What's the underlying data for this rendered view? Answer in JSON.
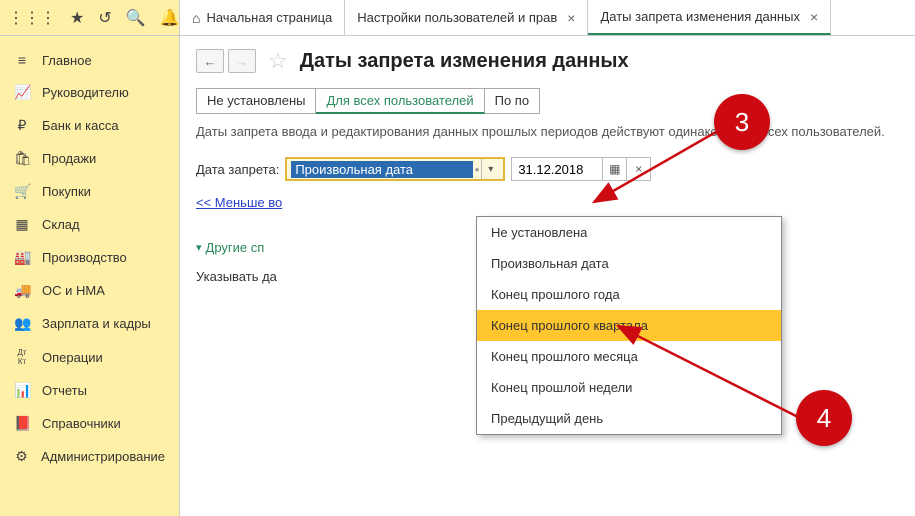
{
  "topbar": {
    "icons": [
      "apps-icon",
      "star-icon",
      "history-icon",
      "search-icon",
      "bell-icon"
    ]
  },
  "tabs": [
    {
      "label": "Начальная страница",
      "closable": false,
      "home": true
    },
    {
      "label": "Настройки пользователей и прав",
      "closable": true
    },
    {
      "label": "Даты запрета изменения данных",
      "closable": true,
      "active": true
    }
  ],
  "sidebar": {
    "items": [
      {
        "ico": "≡",
        "label": "Главное"
      },
      {
        "ico": "📈",
        "label": "Руководителю"
      },
      {
        "ico": "₽",
        "label": "Банк и касса"
      },
      {
        "ico": "🛍",
        "label": "Продажи"
      },
      {
        "ico": "🛒",
        "label": "Покупки"
      },
      {
        "ico": "▦",
        "label": "Склад"
      },
      {
        "ico": "🏭",
        "label": "Производство"
      },
      {
        "ico": "🚚",
        "label": "ОС и НМА"
      },
      {
        "ico": "👥",
        "label": "Зарплата и кадры"
      },
      {
        "ico": "Дт Кт",
        "label": "Операции"
      },
      {
        "ico": "📊",
        "label": "Отчеты"
      },
      {
        "ico": "📕",
        "label": "Справочники"
      },
      {
        "ico": "⚙",
        "label": "Администрирование"
      }
    ]
  },
  "page": {
    "title": "Даты запрета изменения данных",
    "modes": [
      "Не установлены",
      "Для всех пользователей",
      "По по"
    ],
    "selected_mode": 1,
    "desc": "Даты запрета ввода и редактирования данных прошлых периодов действуют одинаково для всех пользователей.",
    "field_label": "Дата запрета:",
    "combo_value": "Произвольная дата",
    "date_value": "31.12.2018",
    "link_less": "<< Меньше во",
    "section": "Другие сп",
    "hint": "Указывать да",
    "options": [
      "Не установлена",
      "Произвольная дата",
      "Конец прошлого года",
      "Конец прошлого квартала",
      "Конец прошлого месяца",
      "Конец прошлой недели",
      "Предыдущий день"
    ],
    "highlight_index": 3
  },
  "badges": {
    "b3": "3",
    "b4": "4"
  }
}
